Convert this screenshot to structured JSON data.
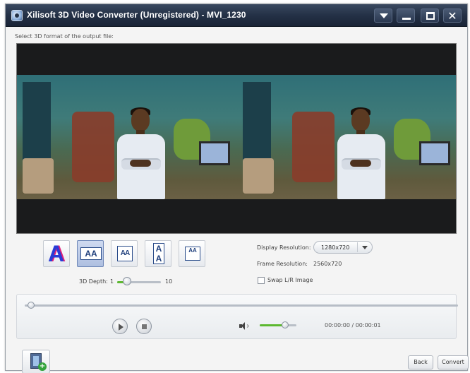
{
  "window": {
    "title": "Xilisoft 3D Video Converter (Unregistered) - MVI_1230",
    "controls": [
      "menu-icon",
      "minimize-icon",
      "maximize-icon",
      "close-icon"
    ],
    "close_glyph": "✕"
  },
  "instruction": "Select 3D format of the output file:",
  "preview": {
    "icons": [
      "video-frame-left",
      "video-frame-right"
    ]
  },
  "formats": [
    {
      "icon": "anaglyph-icon",
      "glyph": "A",
      "selected": false
    },
    {
      "icon": "side-by-side-icon",
      "glyph": "AA",
      "selected": true
    },
    {
      "icon": "side-by-side-half-icon",
      "glyph": "AA",
      "selected": false
    },
    {
      "icon": "top-bottom-icon",
      "glyph": "AA",
      "selected": false
    },
    {
      "icon": "top-bottom-half-icon",
      "glyph": "AA",
      "selected": false
    }
  ],
  "depth": {
    "label": "3D Depth:",
    "min": "1",
    "max": "10",
    "value": 3
  },
  "settings": {
    "display_resolution_label": "Display Resolution:",
    "display_resolution_value": "1280x720",
    "frame_resolution_label": "Frame Resolution:",
    "frame_resolution_value": "2560x720",
    "swap_label": "Swap L/R Image",
    "swap_checked": false
  },
  "player": {
    "seek_position": 0.0,
    "volume_fraction": 0.7,
    "time": "00:00:00 / 00:00:01"
  },
  "footer": {
    "back_label": "Back",
    "convert_label": "Convert"
  },
  "colors": {
    "titlebar": "#243146",
    "accent_green": "#5cb830",
    "selected_format": "#aebfe0"
  }
}
